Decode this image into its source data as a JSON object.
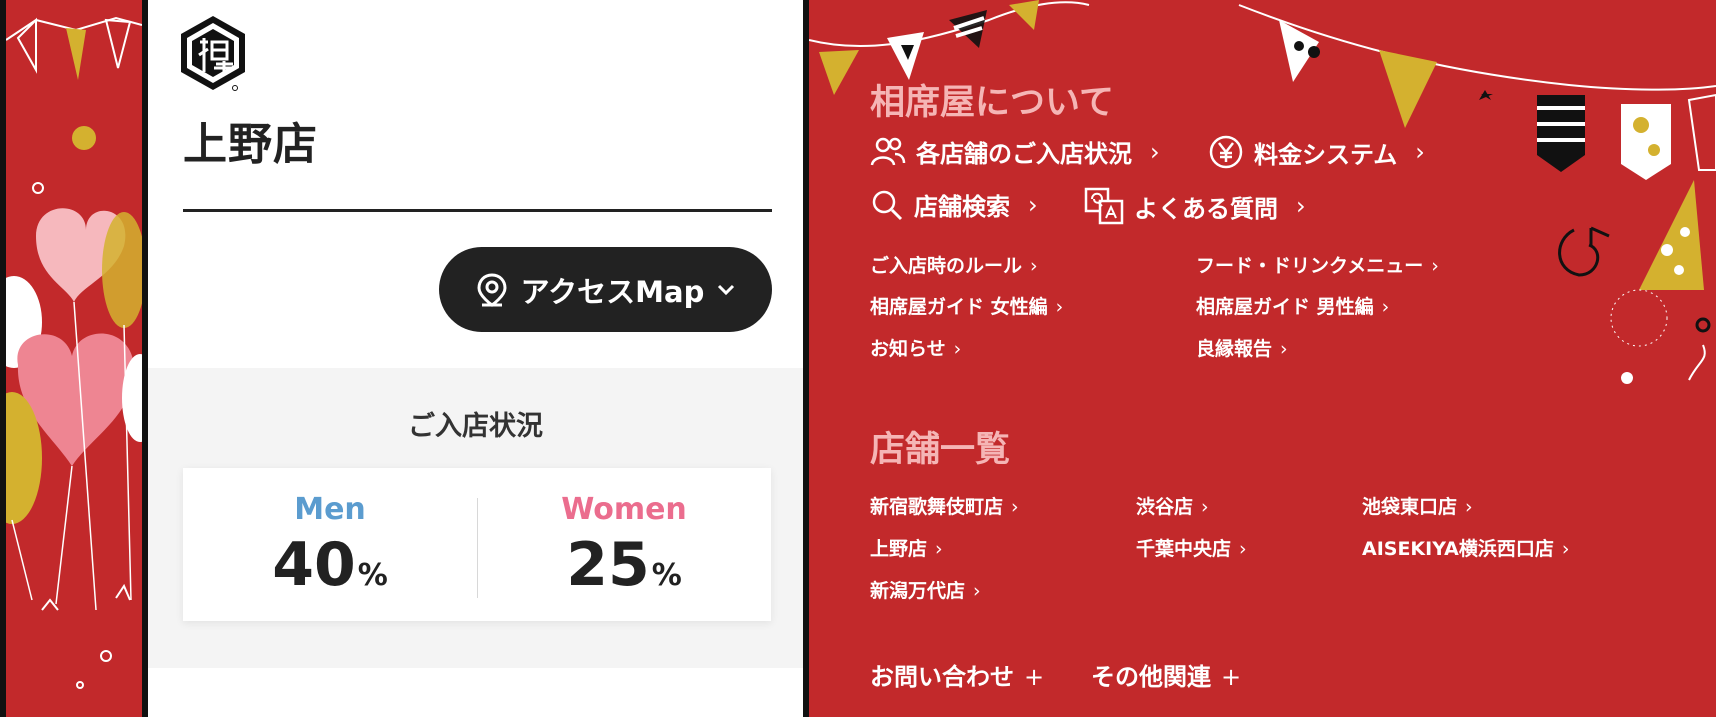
{
  "store": {
    "title": "上野店",
    "access_button": "アクセスMap"
  },
  "status": {
    "heading": "ご入店状況",
    "men_label": "Men",
    "men_value": "40",
    "women_label": "Women",
    "women_value": "25",
    "unit": "%"
  },
  "menu": {
    "about_title": "相席屋について",
    "primary_links": [
      "各店舗のご入店状況",
      "料金システム",
      "店舗検索",
      "よくある質問"
    ],
    "secondary_links": [
      "ご入店時のルール",
      "フード・ドリンクメニュー",
      "相席屋ガイド 女性編",
      "相席屋ガイド 男性編",
      "お知らせ",
      "良縁報告"
    ],
    "stores_title": "店舗一覧",
    "stores": [
      "新宿歌舞伎町店",
      "渋谷店",
      "池袋東口店",
      "上野店",
      "千葉中央店",
      "AISEKIYA横浜西口店",
      "新潟万代店"
    ],
    "footer_links": [
      "お問い合わせ",
      "その他関連"
    ]
  },
  "icons": {
    "logo": "aisekiya-logo",
    "location": "location-pin-icon",
    "chevron": "chevron-down-icon",
    "people": "people-icon",
    "yen": "yen-icon",
    "search": "search-icon",
    "faq": "qa-icon"
  },
  "colors": {
    "brand_red": "#c2292b",
    "dark": "#222222",
    "men": "#5b9ccf",
    "women": "#eb6d8e",
    "section_title": "#f5b5b5"
  }
}
